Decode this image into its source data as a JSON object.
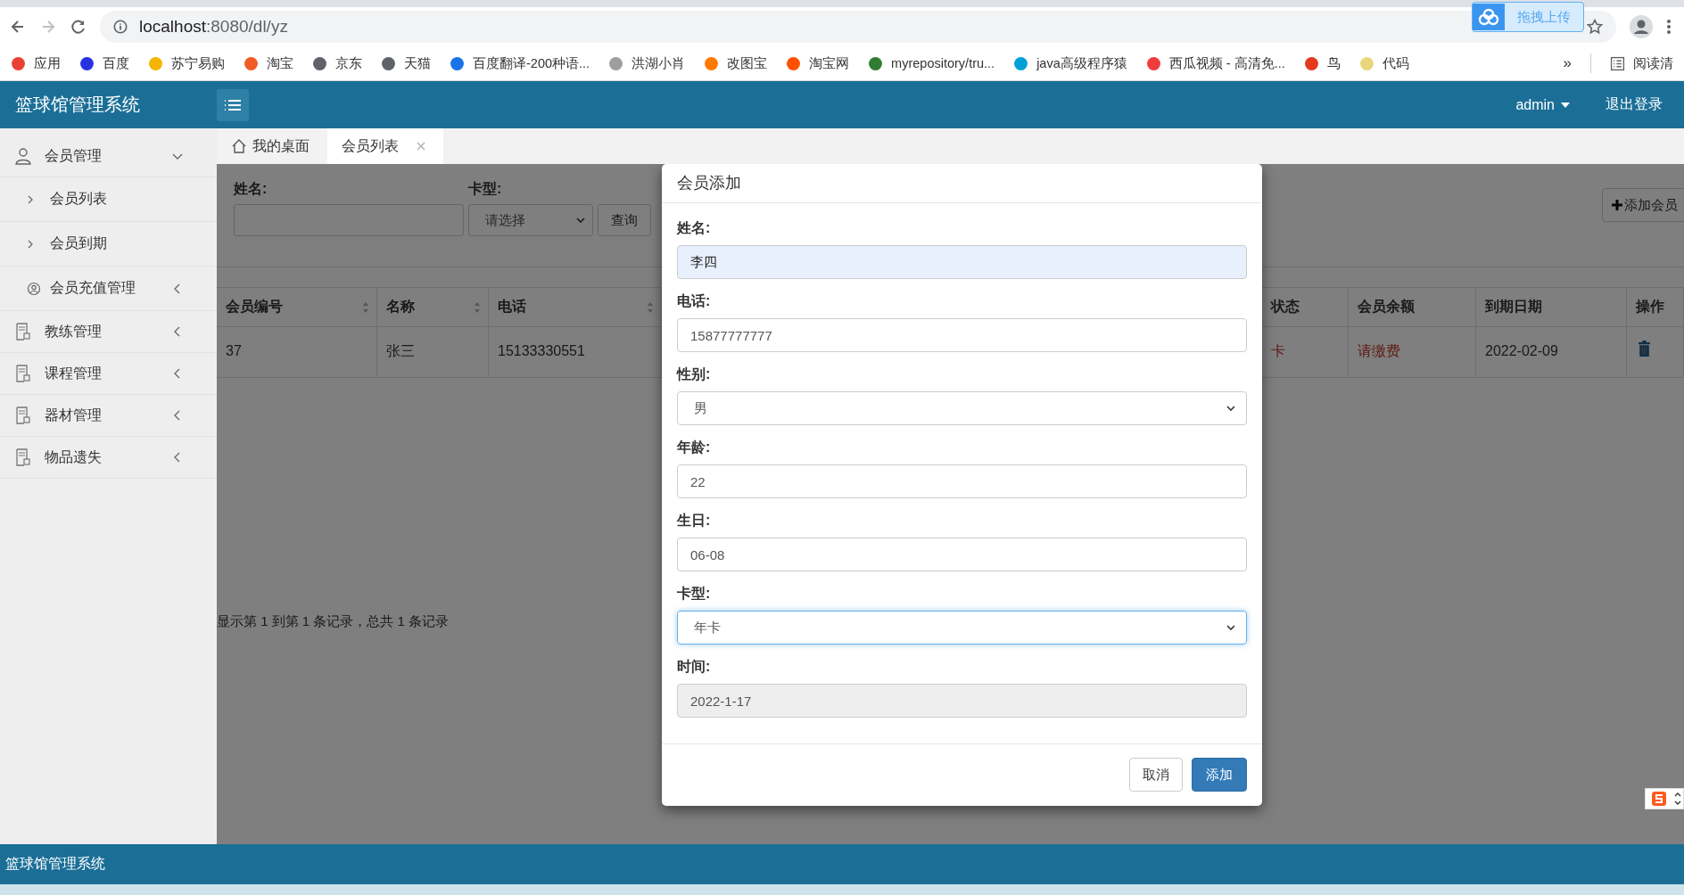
{
  "browser": {
    "url_host": "localhost",
    "url_path": ":8080/dl/yz",
    "upload_widget": "拖拽上传",
    "more": "»",
    "reading_list": "阅读清"
  },
  "bookmarks": [
    {
      "label": "应用",
      "color": "#e94235"
    },
    {
      "label": "百度",
      "color": "#2932e1"
    },
    {
      "label": "苏宁易购",
      "color": "#f5b400"
    },
    {
      "label": "淘宝",
      "color": "#f05a24"
    },
    {
      "label": "京东",
      "color": "#5f6368"
    },
    {
      "label": "天猫",
      "color": "#5f6368"
    },
    {
      "label": "百度翻译-200种语...",
      "color": "#1a73e8"
    },
    {
      "label": "洪湖小肖",
      "color": "#9e9e9e"
    },
    {
      "label": "改图宝",
      "color": "#ff7a00"
    },
    {
      "label": "淘宝网",
      "color": "#ff5000"
    },
    {
      "label": "myrepository/tru...",
      "color": "#2e7d32"
    },
    {
      "label": "java高级程序猿",
      "color": "#00a1d6"
    },
    {
      "label": "西瓜视频 - 高清免...",
      "color": "#f03c3c"
    },
    {
      "label": "鸟",
      "color": "#e5391c"
    },
    {
      "label": "代码",
      "color": "#e8d77a"
    }
  ],
  "app": {
    "title": "篮球馆管理系统",
    "user": "admin",
    "logout": "退出登录"
  },
  "sidebar": [
    {
      "label": "会员管理",
      "expanded": true,
      "children": [
        {
          "label": "会员列表",
          "kind": "link"
        },
        {
          "label": "会员到期",
          "kind": "link"
        },
        {
          "label": "会员充值管理",
          "kind": "group"
        }
      ]
    },
    {
      "label": "教练管理",
      "expanded": false
    },
    {
      "label": "课程管理",
      "expanded": false
    },
    {
      "label": "器材管理",
      "expanded": false
    },
    {
      "label": "物品遗失",
      "expanded": false
    }
  ],
  "tabs": [
    {
      "label": "我的桌面",
      "selected": false,
      "closable": false
    },
    {
      "label": "会员列表",
      "selected": true,
      "closable": true
    }
  ],
  "search": {
    "name_label": "姓名:",
    "card_label": "卡型:",
    "card_placeholder": "请选择",
    "query": "查询",
    "add": "添加会员"
  },
  "table": {
    "columns": [
      {
        "label": "会员编号",
        "sortable": true
      },
      {
        "label": "名称",
        "sortable": true
      },
      {
        "label": "电话",
        "sortable": true
      },
      {
        "label": "状态",
        "sortable": false
      },
      {
        "label": "会员余额",
        "sortable": false
      },
      {
        "label": "到期日期",
        "sortable": false
      },
      {
        "label": "操作",
        "sortable": false
      }
    ],
    "rows": [
      {
        "cells": [
          {
            "kind": "text",
            "text": "37"
          },
          {
            "kind": "text",
            "text": "张三"
          },
          {
            "kind": "text",
            "text": "15133330551"
          },
          {
            "kind": "alert",
            "text": "卡"
          },
          {
            "kind": "alert",
            "text": "请缴费"
          },
          {
            "kind": "text",
            "text": "2022-02-09"
          },
          {
            "kind": "delete"
          }
        ]
      }
    ]
  },
  "pagination": "显示第 1 到第 1 条记录，总共 1 条记录",
  "modal": {
    "title": "会员添加",
    "fields": [
      {
        "label": "姓名:",
        "kind": "input",
        "value": "李四",
        "autofilled": true,
        "focused": false,
        "disabled": false
      },
      {
        "label": "电话:",
        "kind": "input",
        "value": "15877777777",
        "autofilled": false,
        "focused": false,
        "disabled": false
      },
      {
        "label": "性别:",
        "kind": "select",
        "value": "男",
        "autofilled": false,
        "focused": false,
        "disabled": false
      },
      {
        "label": "年龄:",
        "kind": "input",
        "value": "22",
        "autofilled": false,
        "focused": false,
        "disabled": false
      },
      {
        "label": "生日:",
        "kind": "input",
        "value": "06-08",
        "autofilled": false,
        "focused": false,
        "disabled": false
      },
      {
        "label": "卡型:",
        "kind": "select",
        "value": "年卡",
        "autofilled": false,
        "focused": true,
        "disabled": false
      },
      {
        "label": "时间:",
        "kind": "input",
        "value": "2022-1-17",
        "autofilled": false,
        "focused": false,
        "disabled": true
      }
    ],
    "cancel": "取消",
    "submit": "添加"
  },
  "footer": "篮球馆管理系统"
}
